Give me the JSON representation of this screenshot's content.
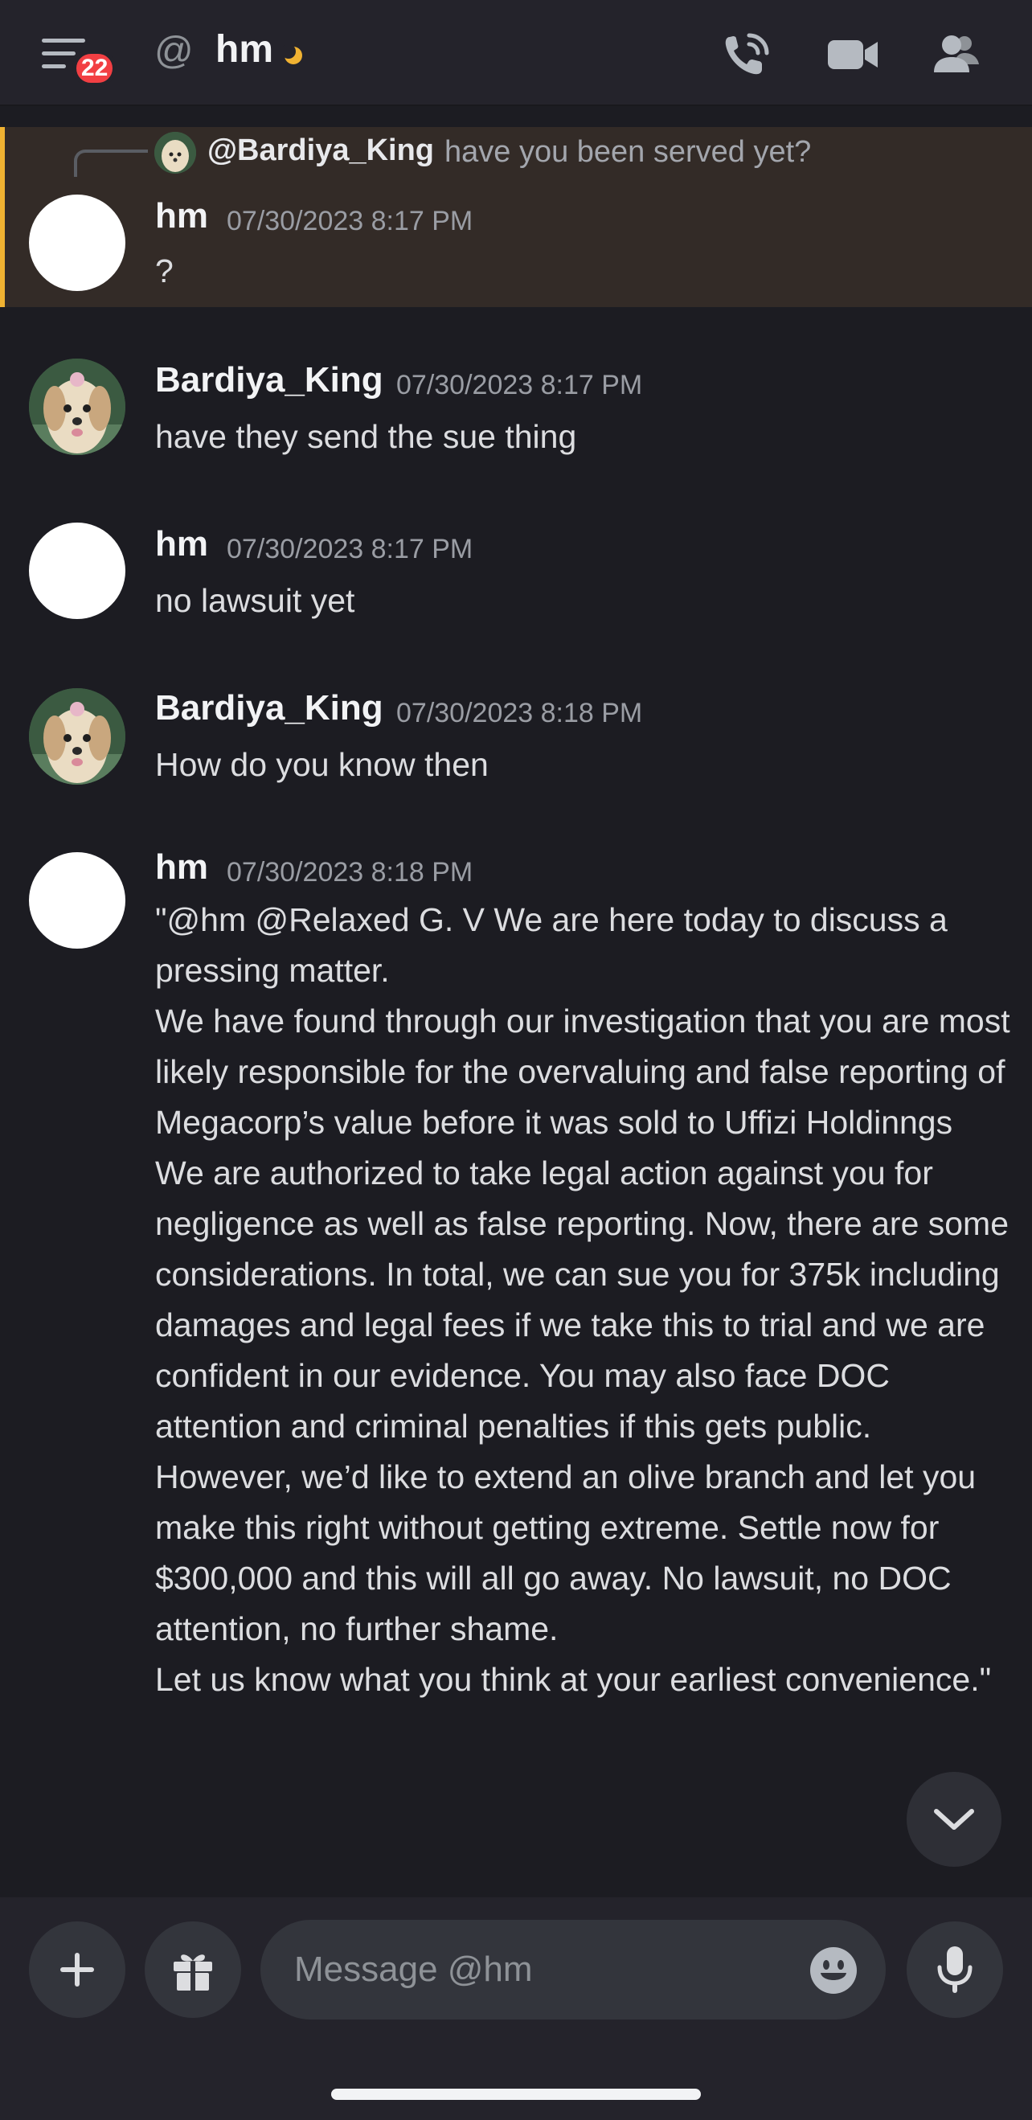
{
  "header": {
    "notification_count": "22",
    "at_symbol": "@",
    "title": "hm",
    "icons": [
      "menu-icon",
      "at-icon",
      "idle-moon-icon",
      "phone-call-icon",
      "video-camera-icon",
      "members-icon"
    ]
  },
  "reply_preview": {
    "username": "@Bardiya_King",
    "text": "have you been served yet?"
  },
  "messages": [
    {
      "username": "hm",
      "timestamp": "07/30/2023 8:17 PM",
      "lines": [
        "?"
      ],
      "highlighted": true
    },
    {
      "username": "Bardiya_King",
      "timestamp": "07/30/2023 8:17 PM",
      "lines": [
        "have they send the sue thing"
      ]
    },
    {
      "username": "hm",
      "timestamp": "07/30/2023 8:17 PM",
      "lines": [
        "no lawsuit yet"
      ]
    },
    {
      "username": "Bardiya_King",
      "timestamp": "07/30/2023 8:18 PM",
      "lines": [
        "How do you know then"
      ]
    },
    {
      "username": "hm",
      "timestamp": "07/30/2023 8:18 PM",
      "lines": [
        "\"@hm @Relaxed G. V We are here today to discuss a pressing matter.",
        "We have found through our investigation that you are most likely responsible for the overvaluing and false reporting of Megacorp’s value before it was sold to Uffizi Holdinngs",
        "We are authorized to take legal action against you for negligence as well as false reporting. Now, there are some considerations. In total, we can sue you for 375k including damages and legal fees if we take this to trial and we are confident in our evidence. You may also face DOC attention and criminal penalties if this gets public.",
        "However, we’d like to extend an olive branch and let you make this right without getting extreme. Settle now for $300,000 and this will all go away. No lawsuit, no DOC attention, no further shame.",
        "Let us know what you think at your earliest convenience.\""
      ]
    }
  ],
  "composer": {
    "placeholder": "Message @hm",
    "icons": [
      "plus-icon",
      "gift-icon",
      "emoji-icon",
      "microphone-icon"
    ]
  },
  "jump_button": {
    "icon": "chevron-down-icon"
  },
  "colors": {
    "background": "#1c1c22",
    "header": "#24232b",
    "highlight": "#332b27",
    "highlight_border": "#f0b232",
    "badge": "#f23f43",
    "input": "#33353c"
  }
}
